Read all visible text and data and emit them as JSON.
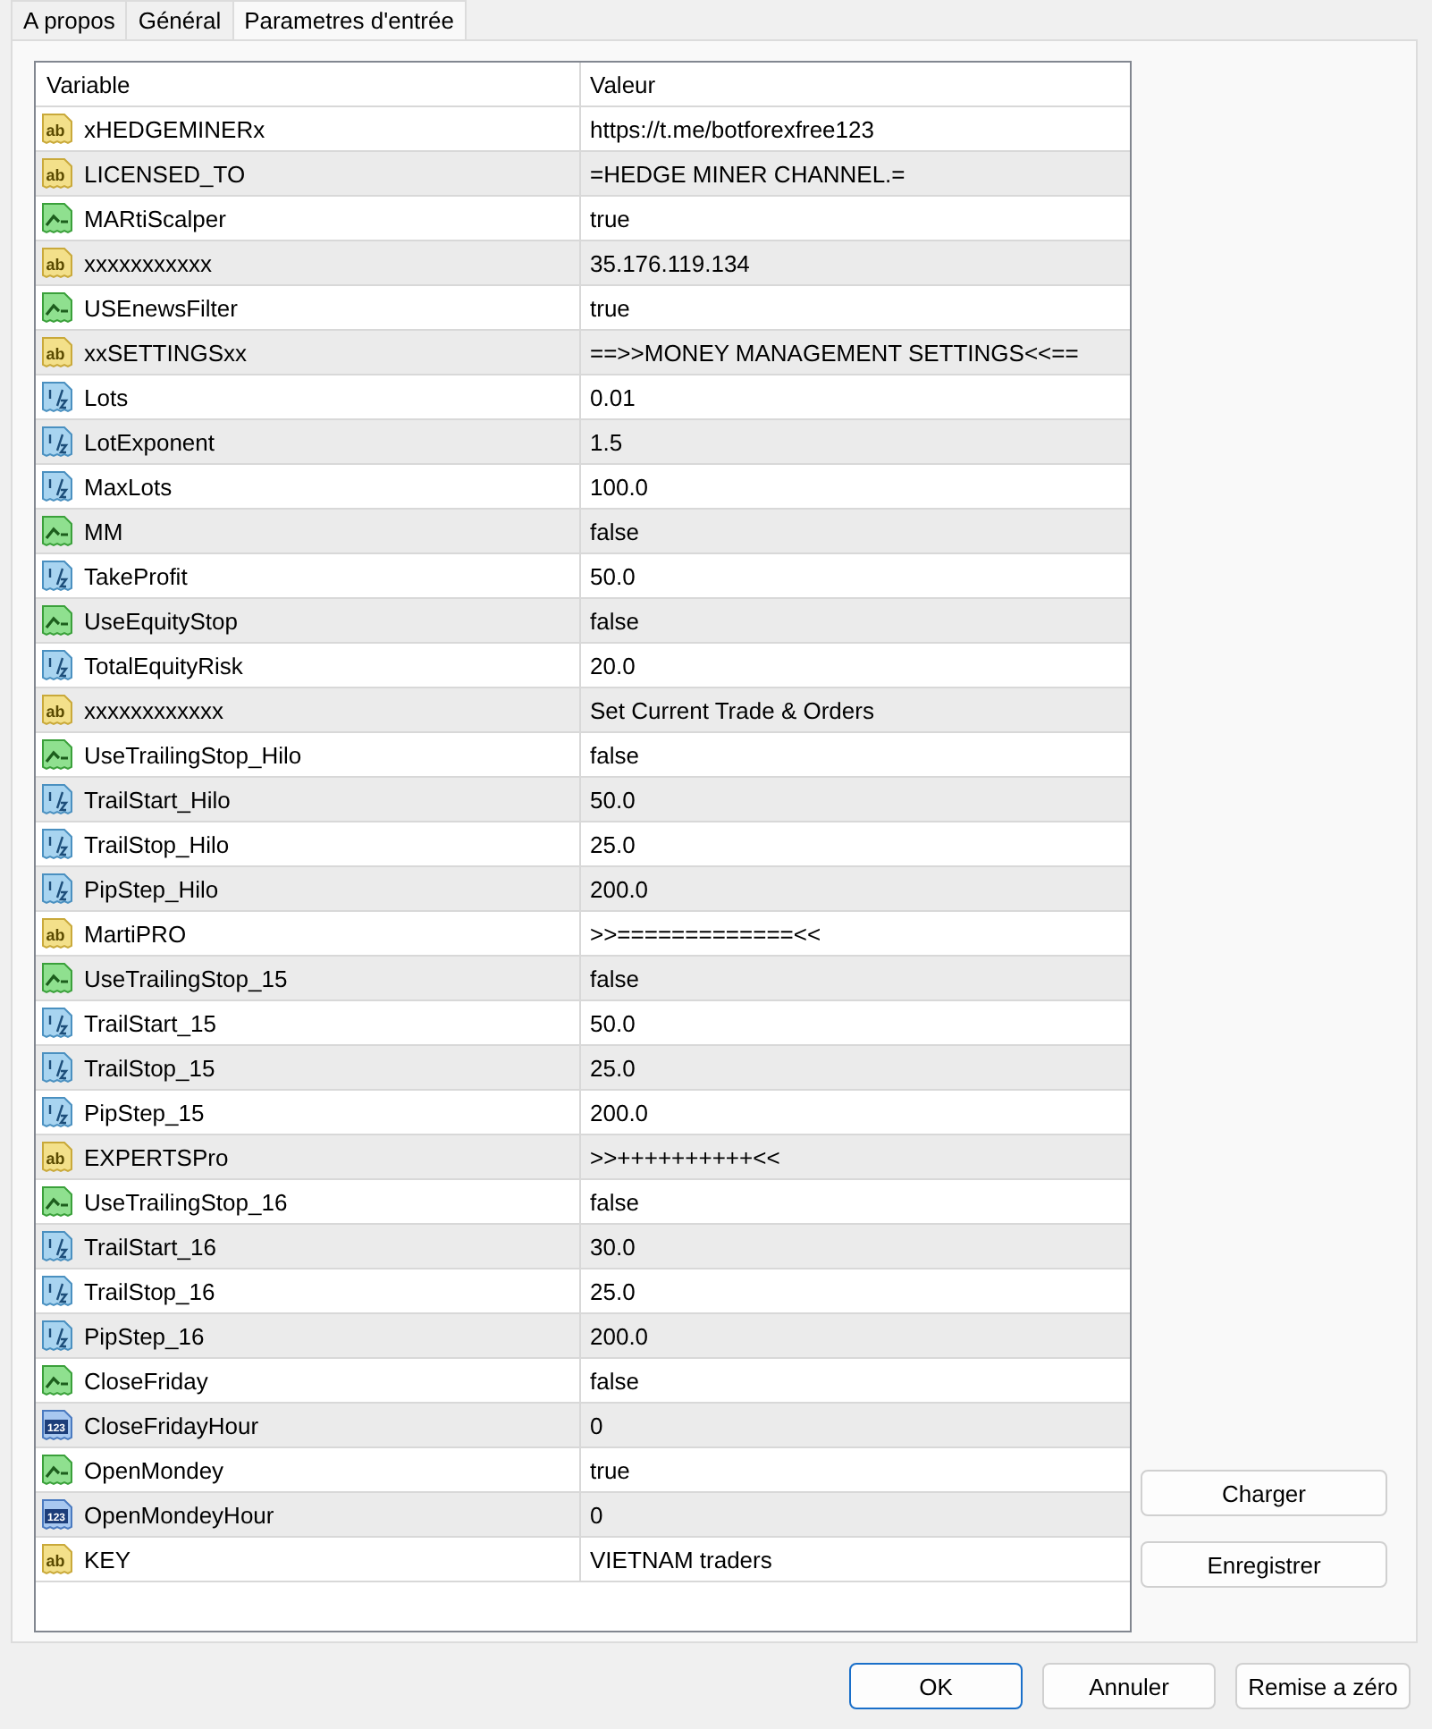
{
  "tabs": [
    {
      "label": "A propos",
      "selected": false
    },
    {
      "label": "Général",
      "selected": false
    },
    {
      "label": "Parametres d'entrée",
      "selected": true
    }
  ],
  "table": {
    "columns": [
      "Variable",
      "Valeur"
    ],
    "rows": [
      {
        "kind": "string",
        "icon_text": "ab",
        "variable": "xHEDGEMINERx",
        "value": "https://t.me/botforexfree123"
      },
      {
        "kind": "string",
        "icon_text": "ab",
        "variable": "LICENSED_TO",
        "value": "=HEDGE MINER CHANNEL.="
      },
      {
        "kind": "bool",
        "variable": "MARtiScalper",
        "value": "true"
      },
      {
        "kind": "string",
        "icon_text": "ab",
        "variable": "xxxxxxxxxxx",
        "value": "35.176.119.134"
      },
      {
        "kind": "bool",
        "variable": "USEnewsFilter",
        "value": "true"
      },
      {
        "kind": "string",
        "icon_text": "ab",
        "variable": "xxSETTINGSxx",
        "value": "==>>MONEY MANAGEMENT SETTINGS<<=="
      },
      {
        "kind": "double",
        "variable": "Lots",
        "value": "0.01"
      },
      {
        "kind": "double",
        "variable": "LotExponent",
        "value": "1.5"
      },
      {
        "kind": "double",
        "variable": "MaxLots",
        "value": "100.0"
      },
      {
        "kind": "bool",
        "variable": "MM",
        "value": "false"
      },
      {
        "kind": "double",
        "variable": "TakeProfit",
        "value": "50.0"
      },
      {
        "kind": "bool",
        "variable": "UseEquityStop",
        "value": "false"
      },
      {
        "kind": "double",
        "variable": "TotalEquityRisk",
        "value": "20.0"
      },
      {
        "kind": "string",
        "icon_text": "ab",
        "variable": "xxxxxxxxxxxx",
        "value": "Set Current Trade & Orders"
      },
      {
        "kind": "bool",
        "variable": "UseTrailingStop_Hilo",
        "value": "false"
      },
      {
        "kind": "double",
        "variable": "TrailStart_Hilo",
        "value": "50.0"
      },
      {
        "kind": "double",
        "variable": "TrailStop_Hilo",
        "value": "25.0"
      },
      {
        "kind": "double",
        "variable": "PipStep_Hilo",
        "value": "200.0"
      },
      {
        "kind": "string",
        "icon_text": "ab",
        "variable": "MartiPRO",
        "value": ">>=============<<"
      },
      {
        "kind": "bool",
        "variable": "UseTrailingStop_15",
        "value": "false"
      },
      {
        "kind": "double",
        "variable": "TrailStart_15",
        "value": "50.0"
      },
      {
        "kind": "double",
        "variable": "TrailStop_15",
        "value": "25.0"
      },
      {
        "kind": "double",
        "variable": "PipStep_15",
        "value": "200.0"
      },
      {
        "kind": "string",
        "icon_text": "ab",
        "variable": "EXPERTSPro",
        "value": ">>++++++++++<<"
      },
      {
        "kind": "bool",
        "variable": "UseTrailingStop_16",
        "value": "false"
      },
      {
        "kind": "double",
        "variable": "TrailStart_16",
        "value": "30.0"
      },
      {
        "kind": "double",
        "variable": "TrailStop_16",
        "value": "25.0"
      },
      {
        "kind": "double",
        "variable": "PipStep_16",
        "value": "200.0"
      },
      {
        "kind": "bool",
        "variable": "CloseFriday",
        "value": "false"
      },
      {
        "kind": "int",
        "icon_text": "123",
        "variable": "CloseFridayHour",
        "value": "0"
      },
      {
        "kind": "bool",
        "variable": "OpenMondey",
        "value": "true"
      },
      {
        "kind": "int",
        "icon_text": "123",
        "variable": "OpenMondeyHour",
        "value": "0"
      },
      {
        "kind": "string",
        "icon_text": "ab",
        "variable": "KEY",
        "value": "VIETNAM traders"
      }
    ]
  },
  "side_buttons": [
    "Charger",
    "Enregistrer"
  ],
  "buttons": [
    {
      "label": "OK",
      "default": true
    },
    {
      "label": "Annuler",
      "default": false
    },
    {
      "label": "Remise a zéro",
      "default": false
    }
  ]
}
